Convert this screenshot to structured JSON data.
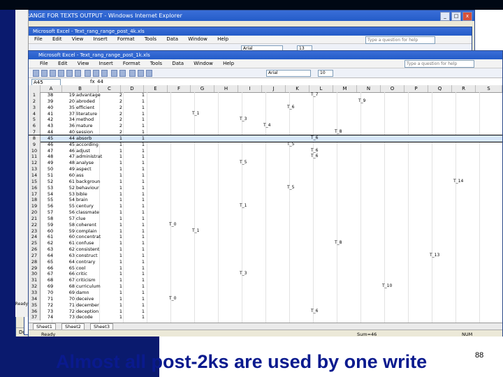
{
  "ie": {
    "title": "RANGE FOR TEXTS OUTPUT - Windows Internet Explorer",
    "status": "Done",
    "min": "_",
    "max": "□",
    "close": "x"
  },
  "excel_back": {
    "title": "Microsoft Excel - Text_rang_range_post_4k.xls",
    "menu": [
      "File",
      "Edit",
      "View",
      "Insert",
      "Format",
      "Tools",
      "Data",
      "Window",
      "Help"
    ],
    "question_placeholder": "Type a question for help",
    "font": "Arial",
    "size": "13"
  },
  "excel": {
    "title": "Microsoft Excel - Text_rang_range_post_1k.xls",
    "menu": [
      "File",
      "Edit",
      "View",
      "Insert",
      "Format",
      "Tools",
      "Data",
      "Window",
      "Help"
    ],
    "question_placeholder": "Type a question for help",
    "font": "Arial",
    "size": "10",
    "namebox": "A45",
    "fx": "fx",
    "formula": "44",
    "columns": [
      "A",
      "B",
      "C",
      "D",
      "E",
      "F",
      "G",
      "H",
      "I",
      "J",
      "K",
      "L",
      "M",
      "N",
      "O",
      "P",
      "Q",
      "R",
      "S"
    ],
    "rows": [
      {
        "rh": "1",
        "a": "38",
        "b": "19",
        "t": "advantage",
        "c": "2",
        "d": "1",
        "tags": [
          {
            "t": "T_7",
            "col": "L"
          }
        ]
      },
      {
        "rh": "2",
        "a": "39",
        "b": "20",
        "t": "abroded",
        "c": "2",
        "d": "1",
        "tags": [
          {
            "t": "T_9",
            "col": "N"
          }
        ]
      },
      {
        "rh": "3",
        "a": "40",
        "b": "35",
        "t": "efficient",
        "c": "2",
        "d": "1",
        "tags": [
          {
            "t": "T_6",
            "col": "K"
          }
        ]
      },
      {
        "rh": "4",
        "a": "41",
        "b": "37",
        "t": "literature",
        "c": "2",
        "d": "1",
        "tags": [
          {
            "t": "T_1",
            "col": "G"
          }
        ]
      },
      {
        "rh": "5",
        "a": "42",
        "b": "34",
        "t": "method",
        "c": "2",
        "d": "1",
        "tags": [
          {
            "t": "T_3",
            "col": "I"
          }
        ]
      },
      {
        "rh": "6",
        "a": "43",
        "b": "36",
        "t": "mature",
        "c": "2",
        "d": "1",
        "tags": [
          {
            "t": "T_4",
            "col": "J"
          }
        ]
      },
      {
        "rh": "7",
        "a": "44",
        "b": "40",
        "t": "session",
        "c": "2",
        "d": "1",
        "tags": [
          {
            "t": "T_8",
            "col": "M"
          }
        ]
      },
      {
        "rh": "8",
        "a": "45",
        "b": "44",
        "t": "absorb",
        "c": "1",
        "d": "1",
        "sel": true,
        "tags": [
          {
            "t": "T_6",
            "col": "L"
          }
        ]
      },
      {
        "rh": "9",
        "a": "46",
        "b": "45",
        "t": "according",
        "c": "1",
        "d": "1",
        "tags": [
          {
            "t": "T_5",
            "col": "K"
          }
        ]
      },
      {
        "rh": "10",
        "a": "47",
        "b": "46",
        "t": "adjust",
        "c": "1",
        "d": "1",
        "tags": [
          {
            "t": "T_6",
            "col": "L"
          }
        ]
      },
      {
        "rh": "11",
        "a": "48",
        "b": "47",
        "t": "administrat",
        "c": "1",
        "d": "1",
        "tags": [
          {
            "t": "T_6",
            "col": "L"
          }
        ]
      },
      {
        "rh": "12",
        "a": "49",
        "b": "48",
        "t": "analyse",
        "c": "1",
        "d": "1",
        "tags": [
          {
            "t": "T_5",
            "col": "I"
          }
        ]
      },
      {
        "rh": "13",
        "a": "50",
        "b": "49",
        "t": "aspect",
        "c": "1",
        "d": "1",
        "tags": []
      },
      {
        "rh": "14",
        "a": "51",
        "b": "60",
        "t": "ass",
        "c": "1",
        "d": "1",
        "tags": []
      },
      {
        "rh": "15",
        "a": "52",
        "b": "61",
        "t": "backgroun",
        "c": "1",
        "d": "1",
        "tags": [
          {
            "t": "T_14",
            "col": "R"
          }
        ]
      },
      {
        "rh": "16",
        "a": "53",
        "b": "52",
        "t": "behaviour",
        "c": "1",
        "d": "1",
        "tags": [
          {
            "t": "T_5",
            "col": "K"
          }
        ]
      },
      {
        "rh": "17",
        "a": "54",
        "b": "53",
        "t": "bible",
        "c": "1",
        "d": "1",
        "tags": []
      },
      {
        "rh": "18",
        "a": "55",
        "b": "54",
        "t": "brain",
        "c": "1",
        "d": "1",
        "tags": []
      },
      {
        "rh": "19",
        "a": "56",
        "b": "55",
        "t": "century",
        "c": "1",
        "d": "1",
        "tags": [
          {
            "t": "T_1",
            "col": "I"
          }
        ]
      },
      {
        "rh": "20",
        "a": "57",
        "b": "56",
        "t": "classmate",
        "c": "1",
        "d": "1",
        "tags": []
      },
      {
        "rh": "21",
        "a": "58",
        "b": "57",
        "t": "clue",
        "c": "1",
        "d": "1",
        "tags": []
      },
      {
        "rh": "22",
        "a": "59",
        "b": "58",
        "t": "coherent",
        "c": "1",
        "d": "1",
        "tags": [
          {
            "t": "T_0",
            "col": "F"
          }
        ]
      },
      {
        "rh": "23",
        "a": "60",
        "b": "59",
        "t": "complain",
        "c": "1",
        "d": "1",
        "tags": [
          {
            "t": "T_1",
            "col": "G"
          }
        ]
      },
      {
        "rh": "24",
        "a": "61",
        "b": "60",
        "t": "concentrat",
        "c": "1",
        "d": "1",
        "tags": []
      },
      {
        "rh": "25",
        "a": "62",
        "b": "61",
        "t": "confuse",
        "c": "1",
        "d": "1",
        "tags": [
          {
            "t": "T_8",
            "col": "M"
          }
        ]
      },
      {
        "rh": "26",
        "a": "63",
        "b": "62",
        "t": "consistent",
        "c": "1",
        "d": "1",
        "tags": []
      },
      {
        "rh": "27",
        "a": "64",
        "b": "63",
        "t": "construct",
        "c": "1",
        "d": "1",
        "tags": [
          {
            "t": "T_13",
            "col": "Q"
          }
        ]
      },
      {
        "rh": "28",
        "a": "65",
        "b": "64",
        "t": "contrary",
        "c": "1",
        "d": "1",
        "tags": []
      },
      {
        "rh": "29",
        "a": "66",
        "b": "65",
        "t": "cool",
        "c": "1",
        "d": "1",
        "tags": []
      },
      {
        "rh": "30",
        "a": "67",
        "b": "66",
        "t": "critic",
        "c": "1",
        "d": "1",
        "tags": [
          {
            "t": "T_3",
            "col": "I"
          }
        ]
      },
      {
        "rh": "31",
        "a": "68",
        "b": "67",
        "t": "criticism",
        "c": "1",
        "d": "1",
        "tags": []
      },
      {
        "rh": "32",
        "a": "69",
        "b": "68",
        "t": "curriculum",
        "c": "1",
        "d": "1",
        "tags": [
          {
            "t": "T_10",
            "col": "O"
          }
        ]
      },
      {
        "rh": "33",
        "a": "70",
        "b": "69",
        "t": "damn",
        "c": "1",
        "d": "1",
        "tags": []
      },
      {
        "rh": "34",
        "a": "71",
        "b": "70",
        "t": "deceive",
        "c": "1",
        "d": "1",
        "tags": [
          {
            "t": "T_0",
            "col": "F"
          }
        ]
      },
      {
        "rh": "35",
        "a": "72",
        "b": "71",
        "t": "december",
        "c": "1",
        "d": "1",
        "tags": []
      },
      {
        "rh": "36",
        "a": "73",
        "b": "72",
        "t": "deception",
        "c": "1",
        "d": "1",
        "tags": [
          {
            "t": "T_6",
            "col": "L"
          }
        ]
      },
      {
        "rh": "37",
        "a": "74",
        "b": "73",
        "t": "decode",
        "c": "1",
        "d": "1",
        "tags": []
      }
    ],
    "sheets": [
      "Sheet1",
      "Sheet2",
      "Sheet3"
    ],
    "status_ready": "Ready",
    "status_sum": "Sum=46",
    "status_num": "NUM"
  },
  "left_strip_labels": [
    "Ready"
  ],
  "caption": "Almost all post-2ks are used by one write",
  "slide_number": "88"
}
